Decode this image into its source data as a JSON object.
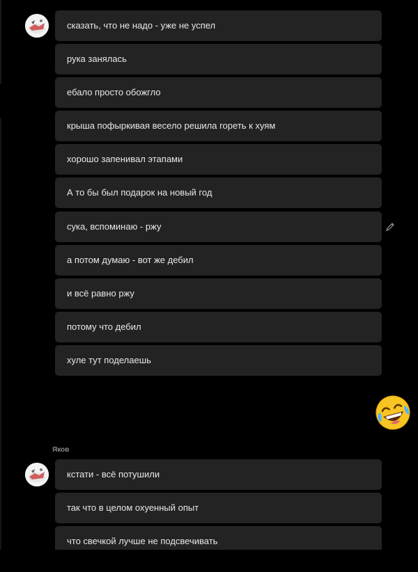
{
  "messages_group1": [
    "сказать, что не надо - уже не успел",
    "рука занялась",
    "ебало просто обожгло",
    "крыша пофыркивая весело решила гореть к хуям",
    "хорошо запенивал этапами",
    "А то бы был подарок на новый год",
    "сука, вспоминаю - ржу",
    "а потом думаю - вот же дебил",
    "и всё равно ржу",
    "потому что дебил",
    "хуле тут поделаешь"
  ],
  "sender_name": "Яков",
  "messages_group2": [
    "кстати - всё потушили",
    "так что в целом охуенный опыт",
    "что свечкой лучше не подсвечивать"
  ],
  "icons": {
    "edit": "pencil-icon",
    "reaction": "rolling-laughing-emoji"
  },
  "colors": {
    "background": "#000000",
    "bubble": "#232323",
    "text": "#e8e8e8",
    "sender": "#8a8a8a"
  }
}
